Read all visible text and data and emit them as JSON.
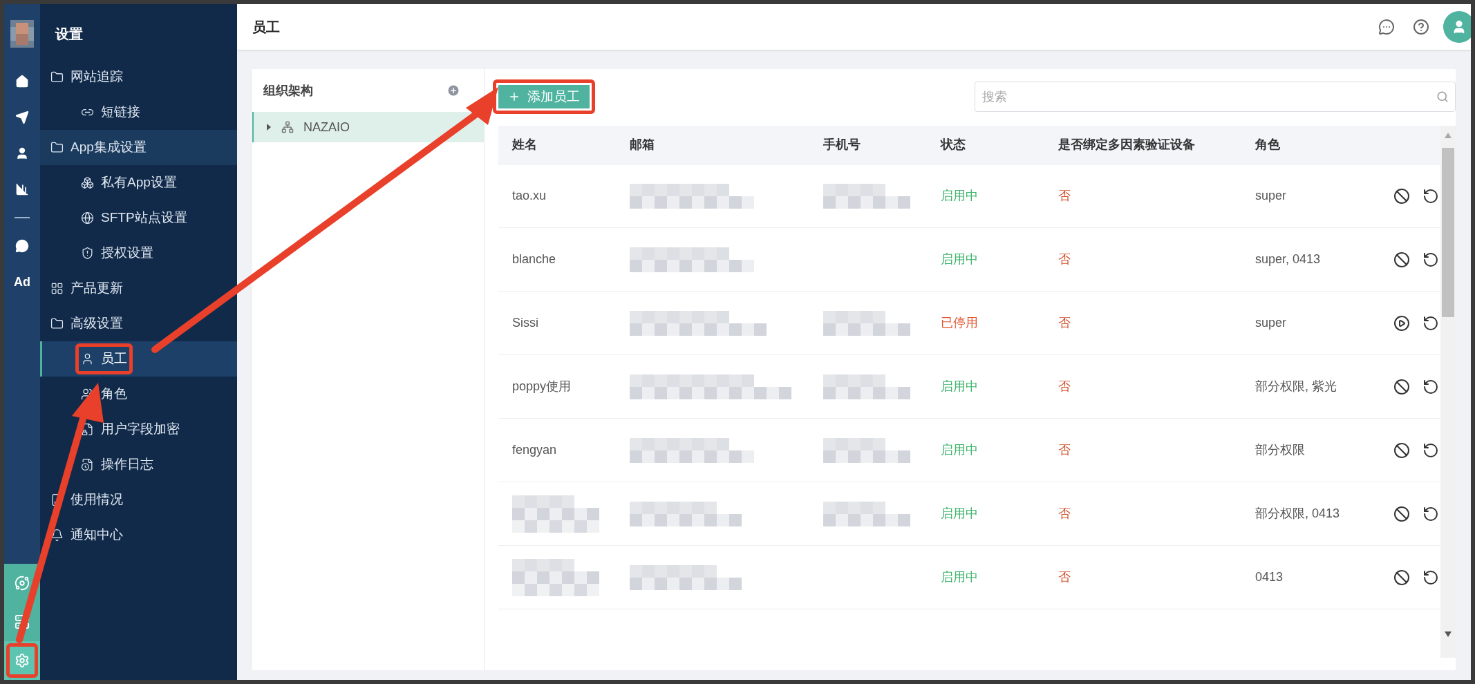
{
  "rail": {
    "top": [
      {
        "kind": "icon",
        "selected": false
      },
      {
        "kind": "icon",
        "selected": false
      },
      {
        "kind": "icon",
        "selected": false
      },
      {
        "kind": "icon",
        "selected": false
      },
      {
        "kind": "divider"
      },
      {
        "kind": "icon",
        "selected": false
      },
      {
        "kind": "text",
        "label": "Ad",
        "selected": false
      }
    ],
    "bottom": [
      {
        "selected": false
      },
      {
        "selected": false
      },
      {
        "selected": true,
        "outlined": true
      }
    ]
  },
  "sidebar": {
    "title": "设置",
    "items": [
      {
        "label": "网站追踪",
        "selected": false,
        "children": [
          {
            "label": "短链接",
            "selected": false
          }
        ]
      },
      {
        "label": "App集成设置",
        "selected": false,
        "highlighted": true,
        "children": [
          {
            "label": "私有App设置",
            "selected": false
          },
          {
            "label": "SFTP站点设置",
            "selected": false
          },
          {
            "label": "授权设置",
            "selected": false
          }
        ]
      },
      {
        "label": "产品更新",
        "selected": false
      },
      {
        "label": "高级设置",
        "selected": false,
        "children": [
          {
            "label": "员工",
            "selected": true,
            "outlined": true
          },
          {
            "label": "角色",
            "selected": false
          },
          {
            "label": "用户字段加密",
            "selected": false
          },
          {
            "label": "操作日志",
            "selected": false
          }
        ]
      },
      {
        "label": "使用情况",
        "selected": false
      },
      {
        "label": "通知中心",
        "selected": false
      }
    ]
  },
  "header": {
    "title": "员工"
  },
  "org": {
    "title": "组织架构",
    "nodes": [
      {
        "label": "NAZAIO",
        "selected": true,
        "expanded": false
      }
    ]
  },
  "add_button": {
    "label": "添加员工",
    "outlined": true
  },
  "search": {
    "placeholder": "搜索"
  },
  "table": {
    "columns": [
      "姓名",
      "邮箱",
      "手机号",
      "状态",
      "是否绑定多因素验证设备",
      "角色"
    ],
    "rows": [
      {
        "name": "tao.xu",
        "phone_shown": true,
        "status": "启用中",
        "active": true,
        "mfa": "否",
        "role": "super"
      },
      {
        "name": "blanche",
        "phone_shown": false,
        "status": "启用中",
        "active": true,
        "mfa": "否",
        "role": "super, 0413"
      },
      {
        "name": "Sissi",
        "phone_shown": true,
        "status": "已停用",
        "active": false,
        "mfa": "否",
        "role": "super"
      },
      {
        "name": "poppy使用",
        "phone_shown": true,
        "status": "启用中",
        "active": true,
        "mfa": "否",
        "role": "部分权限, 紫光"
      },
      {
        "name": "fengyan",
        "phone_shown": true,
        "status": "启用中",
        "active": true,
        "mfa": "否",
        "role": "部分权限"
      },
      {
        "name_redacted": true,
        "phone_shown": true,
        "status": "启用中",
        "active": true,
        "mfa": "否",
        "role": "部分权限, 0413"
      },
      {
        "name_redacted": true,
        "phone_shown": false,
        "status": "启用中",
        "active": true,
        "mfa": "否",
        "role": "0413"
      }
    ]
  }
}
